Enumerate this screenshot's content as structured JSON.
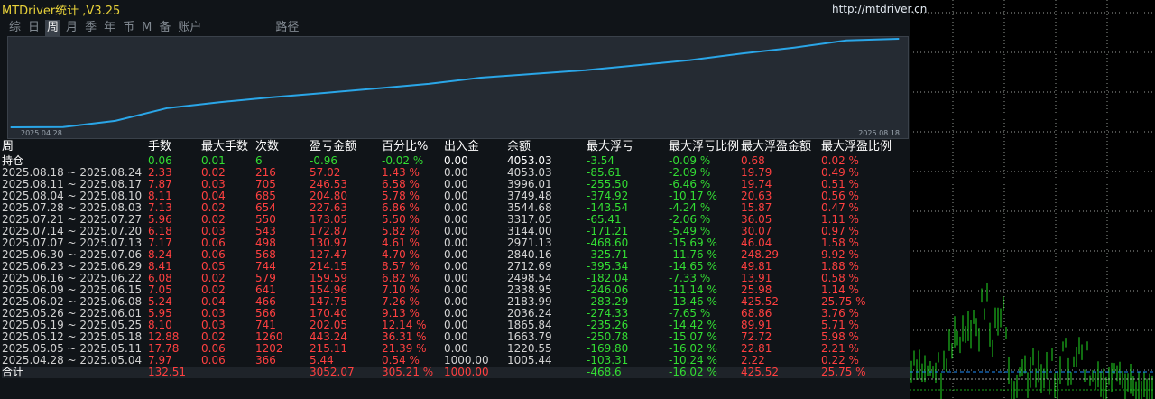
{
  "app": {
    "title": "MTDriver统计 ,V3.25",
    "url": "http://mtdriver.cn"
  },
  "tabs": [
    {
      "label": "综",
      "active": false
    },
    {
      "label": "日",
      "active": false
    },
    {
      "label": "周",
      "active": true
    },
    {
      "label": "月",
      "active": false
    },
    {
      "label": "季",
      "active": false
    },
    {
      "label": "年",
      "active": false
    },
    {
      "label": "币",
      "active": false
    },
    {
      "label": "M",
      "active": false
    },
    {
      "label": "备",
      "active": false
    },
    {
      "label": "账户",
      "active": false
    },
    {
      "label": "路径",
      "active": false
    }
  ],
  "colors": {
    "line": "#2aa6e8",
    "gain": "#ff4040",
    "loss": "#33dd33",
    "header": "#ffffff",
    "accent": "#e8d23a"
  },
  "chart_data": {
    "type": "line",
    "title": "",
    "x_start_label": "2025.04.28",
    "x_end_label": "2025.08.18",
    "x": [
      "2025.04.28",
      "2025.05.05",
      "2025.05.12",
      "2025.05.19",
      "2025.05.26",
      "2025.06.02",
      "2025.06.09",
      "2025.06.16",
      "2025.06.23",
      "2025.06.30",
      "2025.07.07",
      "2025.07.14",
      "2025.07.21",
      "2025.07.28",
      "2025.08.04",
      "2025.08.11",
      "2025.08.18"
    ],
    "series": [
      {
        "values": [
          1000.0,
          1005.44,
          1220.55,
          1663.79,
          1865.84,
          2036.24,
          2183.99,
          2338.95,
          2498.54,
          2712.69,
          2840.16,
          2971.13,
          3144.0,
          3317.05,
          3544.68,
          3749.48,
          3996.01,
          4053.03
        ]
      }
    ],
    "ylim": [
      1000,
      4053.03
    ],
    "grid": false
  },
  "table": {
    "columns": [
      "周",
      "手数",
      "最大手数",
      "次数",
      "盈亏金额",
      "百分比%",
      "出入金",
      "余额",
      "最大浮亏",
      "最大浮亏比例",
      "最大浮盈金额",
      "最大浮盈比例"
    ],
    "hold": {
      "label": "持仓",
      "lots": "0.06",
      "max_lots": "0.01",
      "trades": "6",
      "pnl": "-0.96",
      "pct": "-0.02 %",
      "flow": "0.00",
      "balance": "4053.03",
      "max_dd": "-3.54",
      "max_dd_pct": "-0.09 %",
      "max_fp": "0.68",
      "max_fp_pct": "0.02 %"
    },
    "rows": [
      {
        "period": "2025.08.18 ~ 2025.08.24",
        "lots": "2.33",
        "max_lots": "0.02",
        "trades": "216",
        "pnl": "57.02",
        "pct": "1.43 %",
        "flow": "0.00",
        "balance": "4053.03",
        "max_dd": "-85.61",
        "max_dd_pct": "-2.09 %",
        "max_fp": "19.79",
        "max_fp_pct": "0.49 %"
      },
      {
        "period": "2025.08.11 ~ 2025.08.17",
        "lots": "7.87",
        "max_lots": "0.03",
        "trades": "705",
        "pnl": "246.53",
        "pct": "6.58 %",
        "flow": "0.00",
        "balance": "3996.01",
        "max_dd": "-255.50",
        "max_dd_pct": "-6.46 %",
        "max_fp": "19.74",
        "max_fp_pct": "0.51 %"
      },
      {
        "period": "2025.08.04 ~ 2025.08.10",
        "lots": "8.11",
        "max_lots": "0.04",
        "trades": "685",
        "pnl": "204.80",
        "pct": "5.78 %",
        "flow": "0.00",
        "balance": "3749.48",
        "max_dd": "-374.92",
        "max_dd_pct": "-10.17 %",
        "max_fp": "20.63",
        "max_fp_pct": "0.56 %"
      },
      {
        "period": "2025.07.28 ~ 2025.08.03",
        "lots": "7.13",
        "max_lots": "0.02",
        "trades": "654",
        "pnl": "227.63",
        "pct": "6.86 %",
        "flow": "0.00",
        "balance": "3544.68",
        "max_dd": "-143.54",
        "max_dd_pct": "-4.24 %",
        "max_fp": "15.87",
        "max_fp_pct": "0.47 %"
      },
      {
        "period": "2025.07.21 ~ 2025.07.27",
        "lots": "5.96",
        "max_lots": "0.02",
        "trades": "550",
        "pnl": "173.05",
        "pct": "5.50 %",
        "flow": "0.00",
        "balance": "3317.05",
        "max_dd": "-65.41",
        "max_dd_pct": "-2.06 %",
        "max_fp": "36.05",
        "max_fp_pct": "1.11 %"
      },
      {
        "period": "2025.07.14 ~ 2025.07.20",
        "lots": "6.18",
        "max_lots": "0.03",
        "trades": "543",
        "pnl": "172.87",
        "pct": "5.82 %",
        "flow": "0.00",
        "balance": "3144.00",
        "max_dd": "-171.21",
        "max_dd_pct": "-5.49 %",
        "max_fp": "30.07",
        "max_fp_pct": "0.97 %"
      },
      {
        "period": "2025.07.07 ~ 2025.07.13",
        "lots": "7.17",
        "max_lots": "0.06",
        "trades": "498",
        "pnl": "130.97",
        "pct": "4.61 %",
        "flow": "0.00",
        "balance": "2971.13",
        "max_dd": "-468.60",
        "max_dd_pct": "-15.69 %",
        "max_fp": "46.04",
        "max_fp_pct": "1.58 %"
      },
      {
        "period": "2025.06.30 ~ 2025.07.06",
        "lots": "8.24",
        "max_lots": "0.06",
        "trades": "568",
        "pnl": "127.47",
        "pct": "4.70 %",
        "flow": "0.00",
        "balance": "2840.16",
        "max_dd": "-325.71",
        "max_dd_pct": "-11.76 %",
        "max_fp": "248.29",
        "max_fp_pct": "9.92 %"
      },
      {
        "period": "2025.06.23 ~ 2025.06.29",
        "lots": "8.41",
        "max_lots": "0.05",
        "trades": "744",
        "pnl": "214.15",
        "pct": "8.57 %",
        "flow": "0.00",
        "balance": "2712.69",
        "max_dd": "-395.34",
        "max_dd_pct": "-14.65 %",
        "max_fp": "49.81",
        "max_fp_pct": "1.88 %"
      },
      {
        "period": "2025.06.16 ~ 2025.06.22",
        "lots": "6.08",
        "max_lots": "0.02",
        "trades": "579",
        "pnl": "159.59",
        "pct": "6.82 %",
        "flow": "0.00",
        "balance": "2498.54",
        "max_dd": "-182.04",
        "max_dd_pct": "-7.33 %",
        "max_fp": "13.91",
        "max_fp_pct": "0.58 %"
      },
      {
        "period": "2025.06.09 ~ 2025.06.15",
        "lots": "7.05",
        "max_lots": "0.02",
        "trades": "641",
        "pnl": "154.96",
        "pct": "7.10 %",
        "flow": "0.00",
        "balance": "2338.95",
        "max_dd": "-246.06",
        "max_dd_pct": "-11.14 %",
        "max_fp": "25.98",
        "max_fp_pct": "1.14 %"
      },
      {
        "period": "2025.06.02 ~ 2025.06.08",
        "lots": "5.24",
        "max_lots": "0.04",
        "trades": "466",
        "pnl": "147.75",
        "pct": "7.26 %",
        "flow": "0.00",
        "balance": "2183.99",
        "max_dd": "-283.29",
        "max_dd_pct": "-13.46 %",
        "max_fp": "425.52",
        "max_fp_pct": "25.75 %"
      },
      {
        "period": "2025.05.26 ~ 2025.06.01",
        "lots": "5.95",
        "max_lots": "0.03",
        "trades": "566",
        "pnl": "170.40",
        "pct": "9.13 %",
        "flow": "0.00",
        "balance": "2036.24",
        "max_dd": "-274.33",
        "max_dd_pct": "-7.65 %",
        "max_fp": "68.86",
        "max_fp_pct": "3.76 %"
      },
      {
        "period": "2025.05.19 ~ 2025.05.25",
        "lots": "8.10",
        "max_lots": "0.03",
        "trades": "741",
        "pnl": "202.05",
        "pct": "12.14 %",
        "flow": "0.00",
        "balance": "1865.84",
        "max_dd": "-235.26",
        "max_dd_pct": "-14.42 %",
        "max_fp": "89.91",
        "max_fp_pct": "5.71 %"
      },
      {
        "period": "2025.05.12 ~ 2025.05.18",
        "lots": "12.88",
        "max_lots": "0.02",
        "trades": "1260",
        "pnl": "443.24",
        "pct": "36.31 %",
        "flow": "0.00",
        "balance": "1663.79",
        "max_dd": "-250.78",
        "max_dd_pct": "-15.07 %",
        "max_fp": "72.72",
        "max_fp_pct": "5.98 %"
      },
      {
        "period": "2025.05.05 ~ 2025.05.11",
        "lots": "17.78",
        "max_lots": "0.06",
        "trades": "1202",
        "pnl": "215.11",
        "pct": "21.39 %",
        "flow": "0.00",
        "balance": "1220.55",
        "max_dd": "-169.80",
        "max_dd_pct": "-16.02 %",
        "max_fp": "22.81",
        "max_fp_pct": "2.21 %"
      },
      {
        "period": "2025.04.28 ~ 2025.05.04",
        "lots": "7.97",
        "max_lots": "0.06",
        "trades": "366",
        "pnl": "5.44",
        "pct": "0.54 %",
        "flow": "1000.00",
        "balance": "1005.44",
        "max_dd": "-103.31",
        "max_dd_pct": "-10.24 %",
        "max_fp": "2.22",
        "max_fp_pct": "0.22 %"
      }
    ],
    "total": {
      "label": "合计",
      "lots": "132.51",
      "max_lots": "",
      "trades": "",
      "pnl": "3052.07",
      "pct": "305.21 %",
      "flow": "1000.00",
      "balance": "",
      "max_dd": "-468.6",
      "max_dd_pct": "-16.02 %",
      "max_fp": "425.52",
      "max_fp_pct": "25.75 %"
    }
  }
}
